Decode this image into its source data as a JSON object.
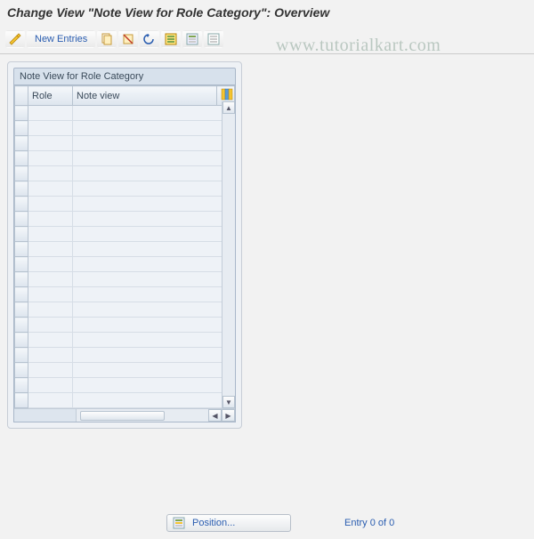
{
  "title": "Change View \"Note View for Role Category\": Overview",
  "watermark": "www.tutorialkart.com",
  "toolbar": {
    "new_entries_label": "New Entries"
  },
  "panel": {
    "title": "Note View for Role Category",
    "columns": {
      "role": "Role",
      "note_view": "Note view"
    },
    "row_count": 20
  },
  "footer": {
    "position_label": "Position...",
    "entry_text": "Entry 0 of 0"
  }
}
